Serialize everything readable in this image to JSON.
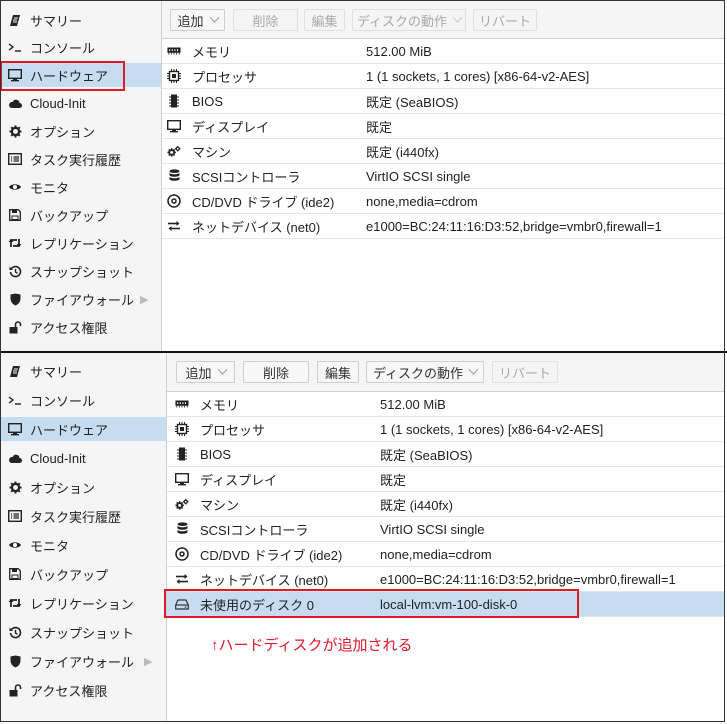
{
  "nav": {
    "items": [
      {
        "label": "サマリー",
        "icon": "summary-icon"
      },
      {
        "label": "コンソール",
        "icon": "console-icon"
      },
      {
        "label": "ハードウェア",
        "icon": "monitor-icon"
      },
      {
        "label": "Cloud-Init",
        "icon": "cloud-icon"
      },
      {
        "label": "オプション",
        "icon": "gear-icon"
      },
      {
        "label": "タスク実行履歴",
        "icon": "list-icon"
      },
      {
        "label": "モニタ",
        "icon": "eye-icon"
      },
      {
        "label": "バックアップ",
        "icon": "floppy-icon"
      },
      {
        "label": "レプリケーション",
        "icon": "retweet-icon"
      },
      {
        "label": "スナップショット",
        "icon": "history-icon"
      },
      {
        "label": "ファイアウォール",
        "icon": "shield-icon"
      },
      {
        "label": "アクセス権限",
        "icon": "unlock-icon"
      }
    ],
    "selected_index": 2
  },
  "toolbar": {
    "add": "追加",
    "remove": "削除",
    "edit": "編集",
    "disk_action": "ディスクの動作",
    "revert": "リバート"
  },
  "hardware": {
    "rows": [
      {
        "name": "メモリ",
        "value": "512.00 MiB",
        "icon": "memory-icon"
      },
      {
        "name": "プロセッサ",
        "value": "1 (1 sockets, 1 cores) [x86-64-v2-AES]",
        "icon": "cpu-icon"
      },
      {
        "name": "BIOS",
        "value": "既定 (SeaBIOS)",
        "icon": "microchip-icon"
      },
      {
        "name": "ディスプレイ",
        "value": "既定",
        "icon": "desktop-icon"
      },
      {
        "name": "マシン",
        "value": "既定 (i440fx)",
        "icon": "cogs-icon"
      },
      {
        "name": "SCSIコントローラ",
        "value": "VirtIO SCSI single",
        "icon": "database-icon"
      },
      {
        "name": "CD/DVD ドライブ (ide2)",
        "value": "none,media=cdrom",
        "icon": "cdrom-icon"
      },
      {
        "name": "ネットデバイス (net0)",
        "value": "e1000=BC:24:11:16:D3:52,bridge=vmbr0,firewall=1",
        "icon": "exchange-icon"
      }
    ],
    "unused_row": {
      "name": "未使用のディスク 0",
      "value": "local-lvm:vm-100-disk-0",
      "icon": "hdd-icon"
    }
  },
  "annotation": "↑ハードディスクが追加される",
  "colors": {
    "highlight": "#e0192b",
    "selection": "#c5dcf1"
  }
}
